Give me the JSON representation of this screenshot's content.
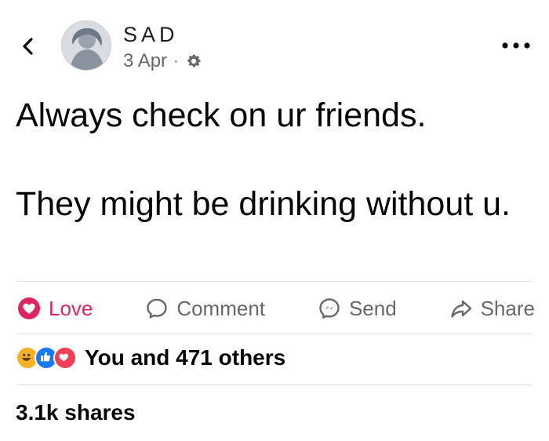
{
  "header": {
    "author_name": "SAD",
    "timestamp": "3 Apr",
    "separator": "·",
    "icons": {
      "back": "back-chevron-icon",
      "audience": "gear-icon",
      "more": "more-options-icon"
    }
  },
  "post": {
    "line1": "Always check on ur friends.",
    "line2": "They might be drinking without u."
  },
  "actions": [
    {
      "label": "Love",
      "icon": "love-heart-icon"
    },
    {
      "label": "Comment",
      "icon": "comment-bubble-icon"
    },
    {
      "label": "Send",
      "icon": "messenger-icon"
    },
    {
      "label": "Share",
      "icon": "share-arrow-icon"
    }
  ],
  "reactions": {
    "summary": "You and 471 others",
    "icons": [
      "haha-reaction-icon",
      "like-reaction-icon",
      "love-reaction-icon"
    ]
  },
  "shares": "3.1k shares",
  "colors": {
    "love": "#e0245e",
    "like": "#1877f2",
    "haha": "#f7b125",
    "secondary_text": "#65676b",
    "divider": "#dadde1"
  }
}
